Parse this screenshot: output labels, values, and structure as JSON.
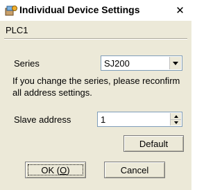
{
  "window": {
    "title": "Individual Device Settings",
    "close_glyph": "✕",
    "icon": "app-icon"
  },
  "device": {
    "name": "PLC1"
  },
  "series": {
    "label": "Series",
    "value": "SJ200",
    "note": "If you change the series, please reconfirm all address settings."
  },
  "slave_address": {
    "label": "Slave address",
    "value": "1"
  },
  "buttons": {
    "default_label": "Default",
    "ok_label": "OK (O)",
    "cancel_label": "Cancel"
  }
}
